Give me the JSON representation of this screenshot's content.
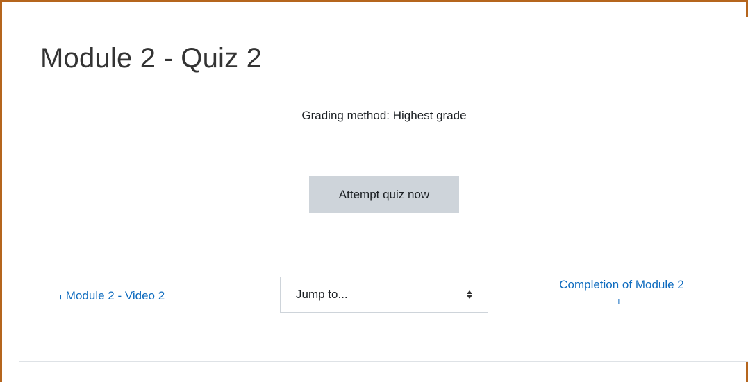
{
  "page": {
    "title": "Module 2 - Quiz 2"
  },
  "quiz": {
    "grading_method": "Grading method: Highest grade",
    "attempt_button_label": "Attempt quiz now"
  },
  "navigation": {
    "prev_arrow": "⟞",
    "prev_label": "Module 2 - Video 2",
    "jump_selected": "Jump to...",
    "next_label": "Completion of Module 2",
    "next_arrow": "⟝"
  },
  "colors": {
    "frame_border": "#b5651d",
    "link": "#0f6cbf",
    "button_bg": "#ced4da"
  }
}
